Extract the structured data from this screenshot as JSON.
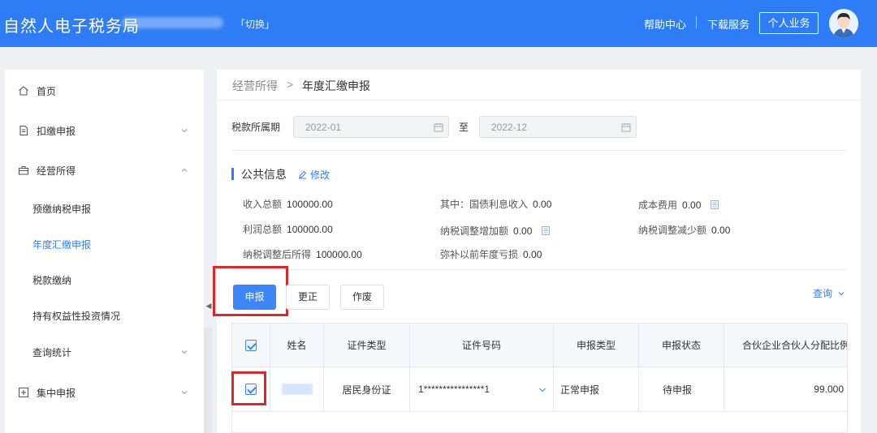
{
  "header": {
    "brand": "自然人电子税务局",
    "switch_label": "「切换」",
    "help_center": "帮助中心",
    "download_service": "下载服务",
    "personal_business": "个人业务",
    "colors": {
      "bar": "#2f7df6"
    }
  },
  "sidebar": {
    "items": [
      {
        "label": "首页",
        "icon": "home-icon"
      },
      {
        "label": "扣缴申报",
        "icon": "document-icon"
      },
      {
        "label": "经营所得",
        "icon": "briefcase-icon"
      },
      {
        "label": "查询统计"
      },
      {
        "label": "集中申报",
        "icon": "plus-box-icon"
      }
    ],
    "sub_items": [
      {
        "label": "预缴纳税申报"
      },
      {
        "label": "年度汇缴申报",
        "active": true
      },
      {
        "label": "税款缴纳"
      },
      {
        "label": "持有权益性投资情况"
      }
    ]
  },
  "breadcrumb": {
    "parent": "经营所得",
    "separator": ">",
    "current": "年度汇缴申报"
  },
  "period": {
    "label": "税款所属期",
    "start": "2022-01",
    "to": "至",
    "end": "2022-12"
  },
  "public_info": {
    "title": "公共信息",
    "edit": "修改",
    "fields": [
      {
        "label": "收入总额",
        "value": "100000.00"
      },
      {
        "label": "其中：国债利息收入",
        "value": "0.00"
      },
      {
        "label": "成本费用",
        "value": "0.00"
      },
      {
        "label": "利润总额",
        "value": "100000.00"
      },
      {
        "label": "纳税调整增加额",
        "value": "0.00"
      },
      {
        "label": "纳税调整减少额",
        "value": "0.00"
      },
      {
        "label": "纳税调整后所得",
        "value": "100000.00"
      },
      {
        "label": "弥补以前年度亏损",
        "value": "0.00"
      }
    ]
  },
  "actions": {
    "declare": "申报",
    "correct": "更正",
    "void": "作废",
    "query": "查询"
  },
  "table": {
    "headers": [
      "姓名",
      "证件类型",
      "证件号码",
      "申报类型",
      "申报状态",
      "合伙企业合伙人分配比例"
    ],
    "rows": [
      {
        "id_type": "居民身份证",
        "id_number": "1****************1",
        "declare_type": "正常申报",
        "status": "待申报",
        "ratio": "99.000"
      }
    ]
  }
}
